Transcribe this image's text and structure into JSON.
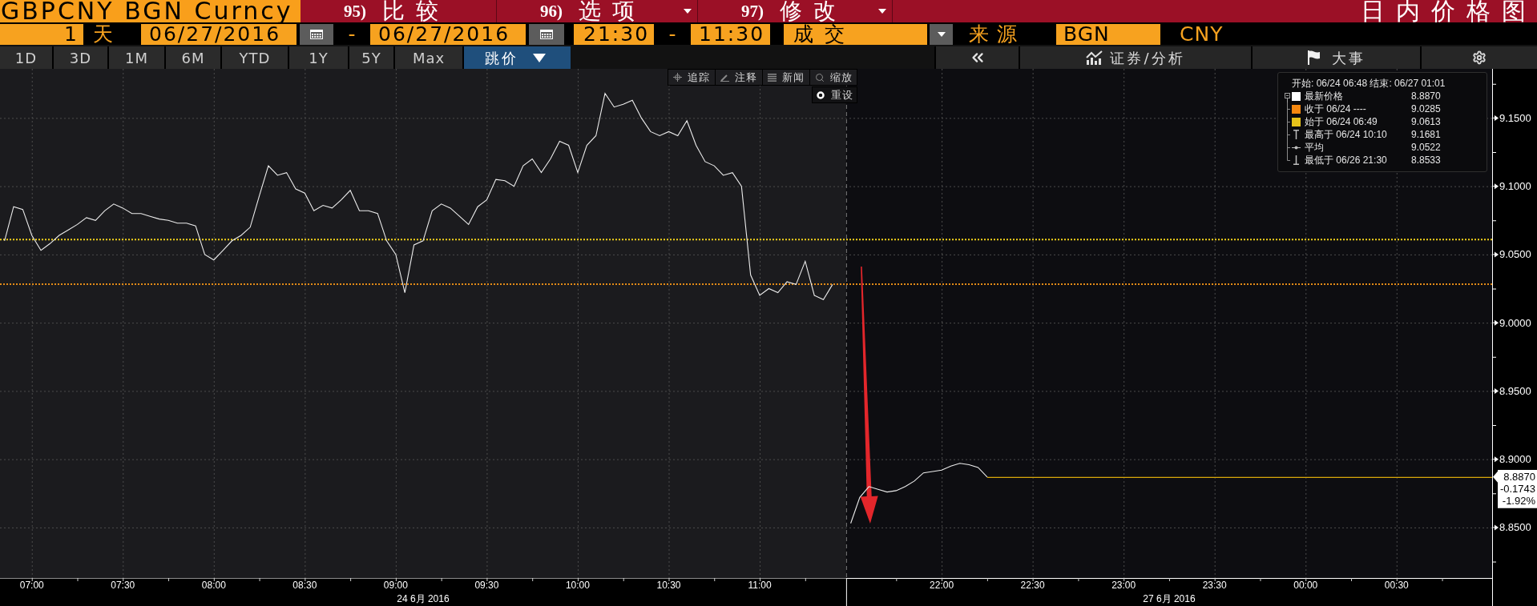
{
  "title_bar": {
    "security": "GBPCNY BGN Curncy",
    "actions": [
      {
        "number": "95)",
        "label": "比较",
        "dropdown": false
      },
      {
        "number": "96)",
        "label": "选项",
        "dropdown": true
      },
      {
        "number": "97)",
        "label": "修改",
        "dropdown": true
      }
    ],
    "title": "日内价格图"
  },
  "params": {
    "period_count": "1",
    "period_unit": "天",
    "start_date": "06/27/2016",
    "date_separator": "-",
    "end_date": "06/27/2016",
    "start_time": "21:30",
    "time_separator": "-",
    "end_time": "11:30",
    "field": "成交",
    "source_label": "来源",
    "source": "BGN",
    "currency": "CNY"
  },
  "ranges": [
    {
      "label": "1D",
      "selected": false
    },
    {
      "label": "3D",
      "selected": false
    },
    {
      "label": "1M",
      "selected": false
    },
    {
      "label": "6M",
      "selected": false
    },
    {
      "label": "YTD",
      "selected": false
    },
    {
      "label": "1Y",
      "selected": false
    },
    {
      "label": "5Y",
      "selected": false
    },
    {
      "label": "Max",
      "selected": false
    }
  ],
  "chart_type": {
    "label": "跳价"
  },
  "side_buttons": [
    {
      "kind": "collapse"
    },
    {
      "kind": "analysis",
      "label": "证券/分析"
    },
    {
      "kind": "events",
      "label": "大事"
    },
    {
      "kind": "settings"
    }
  ],
  "chart": {
    "tools": [
      {
        "kind": "track",
        "label": "追踪"
      },
      {
        "kind": "annotate",
        "label": "注释"
      },
      {
        "kind": "news",
        "label": "新闻"
      },
      {
        "kind": "zoom",
        "label": "缩放"
      }
    ],
    "reset": {
      "label": "重设"
    },
    "legend": {
      "range": "开始: 06/24 06:48 结束: 06/27 01:01",
      "expanded": true,
      "rows": [
        {
          "kind": "swatch",
          "color": "#ffffff",
          "label": "最新价格",
          "value": "8.8870"
        },
        {
          "kind": "swatch",
          "color": "#f5870f",
          "label": "收于 06/24 ----",
          "value": "9.0285"
        },
        {
          "kind": "swatch",
          "color": "#e6c21a",
          "label": "始于 06/24 06:49",
          "value": "9.0613"
        },
        {
          "kind": "high",
          "label": "最高于 06/24 10:10",
          "value": "9.1681"
        },
        {
          "kind": "average",
          "label": "平均",
          "value": "9.0522"
        },
        {
          "kind": "low",
          "label": "最低于 06/26 21:30",
          "value": "8.8533"
        }
      ]
    },
    "chart_data": {
      "type": "line",
      "grid": true,
      "categories": [
        null,
        null,
        null,
        "07:00",
        null,
        null,
        null,
        null,
        null,
        null,
        null,
        null,
        null,
        "07:30",
        null,
        null,
        null,
        null,
        null,
        null,
        null,
        null,
        null,
        "08:00",
        null,
        null,
        null,
        null,
        null,
        null,
        null,
        null,
        null,
        "08:30",
        null,
        null,
        null,
        null,
        null,
        null,
        null,
        null,
        null,
        "09:00",
        null,
        null,
        null,
        null,
        null,
        null,
        null,
        null,
        null,
        "09:30",
        null,
        null,
        null,
        null,
        null,
        null,
        null,
        null,
        null,
        "10:00",
        null,
        null,
        null,
        null,
        null,
        null,
        null,
        null,
        null,
        "10:30",
        null,
        null,
        null,
        null,
        null,
        null,
        null,
        null,
        null,
        "11:00",
        null,
        null,
        null,
        null,
        null,
        null,
        null,
        null,
        null,
        null,
        null,
        null,
        null,
        null,
        null,
        null,
        null,
        null,
        null,
        "22:00",
        null,
        null,
        null,
        null,
        null,
        null,
        null,
        null,
        null,
        "22:30",
        null,
        null,
        null,
        null,
        null,
        null,
        null,
        null,
        null,
        "23:00",
        null,
        null,
        null,
        null,
        null,
        null,
        null,
        null,
        null,
        "23:30",
        null,
        null,
        null,
        null,
        null,
        null,
        null,
        null,
        null,
        "00:00",
        null,
        null,
        null,
        null,
        null,
        null,
        null,
        null,
        null,
        "00:30",
        null,
        null,
        null,
        null,
        null,
        null,
        null,
        null,
        null,
        null
      ],
      "values": [
        9.06,
        9.085,
        9.083,
        9.064,
        9.053,
        9.058,
        9.064,
        9.068,
        9.072,
        9.077,
        9.075,
        9.082,
        9.087,
        9.084,
        9.08,
        9.08,
        9.078,
        9.076,
        9.075,
        9.073,
        9.073,
        9.071,
        9.05,
        9.046,
        9.053,
        9.06,
        9.064,
        9.07,
        9.093,
        9.115,
        9.108,
        9.11,
        9.098,
        9.095,
        9.082,
        9.086,
        9.084,
        9.09,
        9.097,
        9.082,
        9.082,
        9.08,
        9.06,
        9.05,
        9.022,
        9.057,
        9.06,
        9.082,
        9.087,
        9.084,
        9.078,
        9.072,
        9.085,
        9.09,
        9.105,
        9.104,
        9.1,
        9.115,
        9.12,
        9.11,
        9.12,
        9.133,
        9.13,
        9.11,
        9.13,
        9.137,
        9.168,
        9.158,
        9.16,
        9.163,
        9.15,
        9.14,
        9.137,
        9.14,
        9.137,
        9.148,
        9.13,
        9.118,
        9.115,
        9.108,
        9.11,
        9.1,
        9.035,
        9.02,
        9.025,
        9.022,
        9.03,
        9.028,
        9.045,
        9.02,
        9.017,
        9.028,
        null,
        8.853,
        8.872,
        8.88,
        8.878,
        8.876,
        8.877,
        8.88,
        8.884,
        8.89,
        8.891,
        8.892,
        8.895,
        8.897,
        8.896,
        8.894,
        8.887,
        null,
        null,
        null,
        null,
        null,
        null,
        null,
        null,
        null,
        null,
        null,
        null,
        null,
        null,
        null,
        null,
        null,
        null,
        null,
        null,
        null,
        null,
        null,
        null,
        null,
        null,
        null,
        null,
        null,
        null,
        null,
        null,
        null,
        null,
        null,
        null,
        null,
        null,
        null,
        null,
        null,
        null,
        null,
        null,
        null,
        null,
        null,
        null,
        null,
        null,
        null,
        null,
        null,
        null,
        null
      ],
      "ylim": [
        8.813,
        9.186
      ],
      "yticks": [
        {
          "value": 9.15,
          "label": "9.1500"
        },
        {
          "value": 9.1,
          "label": "9.1000"
        },
        {
          "value": 9.05,
          "label": "9.0500"
        },
        {
          "value": 9.0,
          "label": "9.0000"
        },
        {
          "value": 8.95,
          "label": "8.9500"
        },
        {
          "value": 8.9,
          "label": "8.9000"
        },
        {
          "value": 8.85,
          "label": "8.8500"
        }
      ],
      "ref_lines": [
        {
          "axis": "y",
          "value": 9.0613,
          "color": "#f2d21a"
        },
        {
          "axis": "y",
          "value": 9.0285,
          "color": "#e38b17"
        }
      ]
    },
    "price_tag": {
      "price": "8.8870",
      "change": "-0.1743",
      "change_percent": "-1.92%"
    },
    "date_labels": [
      "24 6月 2016",
      "27 6月 2016"
    ]
  }
}
